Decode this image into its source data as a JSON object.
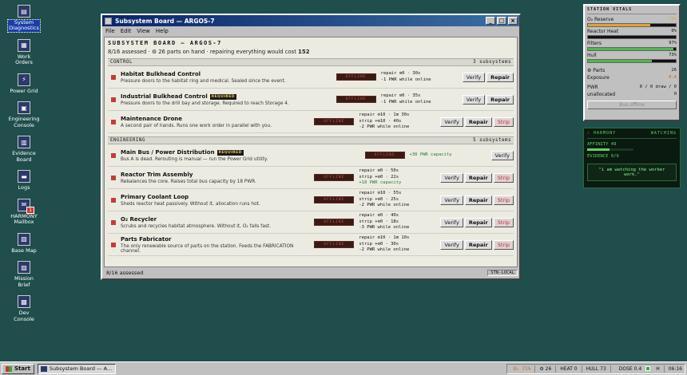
{
  "desktop": {
    "icons": [
      {
        "label": "System\nDiagnostics",
        "glyph": "▤"
      },
      {
        "label": "Work\nOrders",
        "glyph": "▦"
      },
      {
        "label": "Power Grid",
        "glyph": "⚡"
      },
      {
        "label": "Engineering\nConsole",
        "glyph": "▣"
      },
      {
        "label": "Evidence\nBoard",
        "glyph": "▥"
      },
      {
        "label": "Logs",
        "glyph": "▬"
      },
      {
        "label": "HARMONY\nMailbox",
        "glyph": "✉",
        "badge": "1"
      },
      {
        "label": "Base Map",
        "glyph": "▧"
      },
      {
        "label": "Mission\nBrief",
        "glyph": "▨"
      },
      {
        "label": "Dev\nConsole",
        "glyph": "▩"
      }
    ]
  },
  "window": {
    "title": "Subsystem Board — ARGOS-7",
    "menu": [
      "File",
      "Edit",
      "View",
      "Help"
    ],
    "header_title": "SUBSYSTEM BOARD — ARGOS-7",
    "assessed": "8/16 assessed",
    "parts_on_hand": "⚙ 26 parts on hand",
    "repair_all_text": "repairing everything would cost",
    "repair_all_cost": "152",
    "sections": [
      {
        "name": "CONTROL",
        "count": "3 subsystems",
        "rows": [
          {
            "name": "Habitat Bulkhead Control",
            "required": false,
            "desc": "Pressure doors to the habitat ring and medical. Sealed since the event.",
            "status": "OFFLINE",
            "lines": [
              {
                "t": "repair ⚙0 · 30s",
                "g": false
              },
              {
                "t": "-1 PWR while online",
                "g": false
              }
            ],
            "buttons": [
              "Verify",
              "Repair"
            ]
          },
          {
            "name": "Industrial Bulkhead Control",
            "required": true,
            "req_label": "REQUIRED",
            "desc": "Pressure doors to the drill bay and storage. Required to reach Storage 4.",
            "status": "OFFLINE",
            "lines": [
              {
                "t": "repair ⚙0 · 35s",
                "g": false
              },
              {
                "t": "-1 PWR while online",
                "g": false
              }
            ],
            "buttons": [
              "Verify",
              "Repair"
            ]
          },
          {
            "name": "Maintenance Drone",
            "required": false,
            "desc": "A second pair of hands. Runs one work order in parallel with you.",
            "status": "OFFLINE",
            "lines": [
              {
                "t": "repair ⚙10 · 1m 30s",
                "g": false
              },
              {
                "t": "strip +⚙10 · 40s",
                "g": false
              },
              {
                "t": "-2 PWR while online",
                "g": false
              }
            ],
            "buttons": [
              "Verify",
              "Repair",
              "Strip"
            ]
          }
        ]
      },
      {
        "name": "ENGINEERING",
        "count": "5 subsystems",
        "rows": [
          {
            "name": "Main Bus / Power Distribution",
            "required": true,
            "req_label": "REQUIRED",
            "desc": "Bus A is dead. Rerouting is manual — run the Power Grid utility.",
            "status": "OFFLINE",
            "lines": [
              {
                "t": "+30 PWR capacity",
                "g": true
              }
            ],
            "buttons": [
              "Verify"
            ]
          },
          {
            "name": "Reactor Trim Assembly",
            "required": false,
            "desc": "Rebalances the core. Raises total bus capacity by 18 PWR.",
            "status": "OFFLINE",
            "lines": [
              {
                "t": "repair ⚙0 · 50s",
                "g": false
              },
              {
                "t": "strip +⚙0 · 22s",
                "g": false
              },
              {
                "t": "+18 PWR capacity",
                "g": true
              }
            ],
            "buttons": [
              "Verify",
              "Repair",
              "Strip"
            ]
          },
          {
            "name": "Primary Coolant Loop",
            "required": false,
            "desc": "Sheds reactor heat passively. Without it, allocation runs hot.",
            "status": "OFFLINE",
            "lines": [
              {
                "t": "repair ⚙10 · 55s",
                "g": false
              },
              {
                "t": "strip +⚙0 · 25s",
                "g": false
              },
              {
                "t": "-2 PWR while online",
                "g": false
              }
            ],
            "buttons": [
              "Verify",
              "Repair",
              "Strip"
            ]
          },
          {
            "name": "O₂ Recycler",
            "required": false,
            "desc": "Scrubs and recycles habitat atmosphere. Without it, O₂ falls fast.",
            "status": "OFFLINE",
            "lines": [
              {
                "t": "repair ⚙0 · 40s",
                "g": false
              },
              {
                "t": "strip +⚙0 · 18s",
                "g": false
              },
              {
                "t": "-3 PWR while online",
                "g": false
              }
            ],
            "buttons": [
              "Verify",
              "Repair",
              "Strip"
            ]
          },
          {
            "name": "Parts Fabricator",
            "required": false,
            "desc": "The only renewable source of parts on the station. Feeds the FABRICATION channel.",
            "status": "OFFLINE",
            "lines": [
              {
                "t": "repair ⚙10 · 1m 10s",
                "g": false
              },
              {
                "t": "strip +⚙0 · 30s",
                "g": false
              },
              {
                "t": "-2 PWR while online",
                "g": false
              }
            ],
            "buttons": [
              "Verify",
              "Repair",
              "Strip"
            ]
          }
        ]
      }
    ],
    "status_left": "8/16 assessed",
    "status_right": "STN-LOCAL"
  },
  "vitals": {
    "title": "STATION VITALS",
    "rows": [
      {
        "label": "O₂ Reserve",
        "value": "71%",
        "pct": 71,
        "color": "#e0a23a"
      },
      {
        "label": "Reactor Heat",
        "value": "0%",
        "pct": 0,
        "color": "#d04a3a"
      },
      {
        "label": "Filters",
        "value": "97%",
        "pct": 97,
        "color": "#4fb84a"
      },
      {
        "label": "Hull",
        "value": "73%",
        "pct": 73,
        "color": "#4fb84a"
      }
    ],
    "parts_label": "⚙ Parts",
    "parts_value": "26",
    "exposure_label": "Exposure",
    "exposure_value": "0.4",
    "pwr_label": "PWR",
    "pwr_value": "0 / 0 draw / 0",
    "unalloc_label": "unallocated",
    "unalloc_value": "0",
    "bus_button": "Bus offline"
  },
  "harmony": {
    "title": "› HARMONY",
    "status": "WATCHING",
    "affinity": "AFFINITY 49",
    "affinity_pct": 49,
    "evidence": "EVIDENCE 0/9",
    "message": "\"i am watching the worker work.\""
  },
  "taskbar": {
    "start": "Start",
    "task": "Subsystem Board — A...",
    "tray": {
      "o2": "O₂ 71%",
      "parts": "⚙ 26",
      "heat": "HEAT 0",
      "hull": "HULL 73",
      "dose": "DOSE 0.4",
      "h": "H",
      "clock": "06:16"
    }
  }
}
